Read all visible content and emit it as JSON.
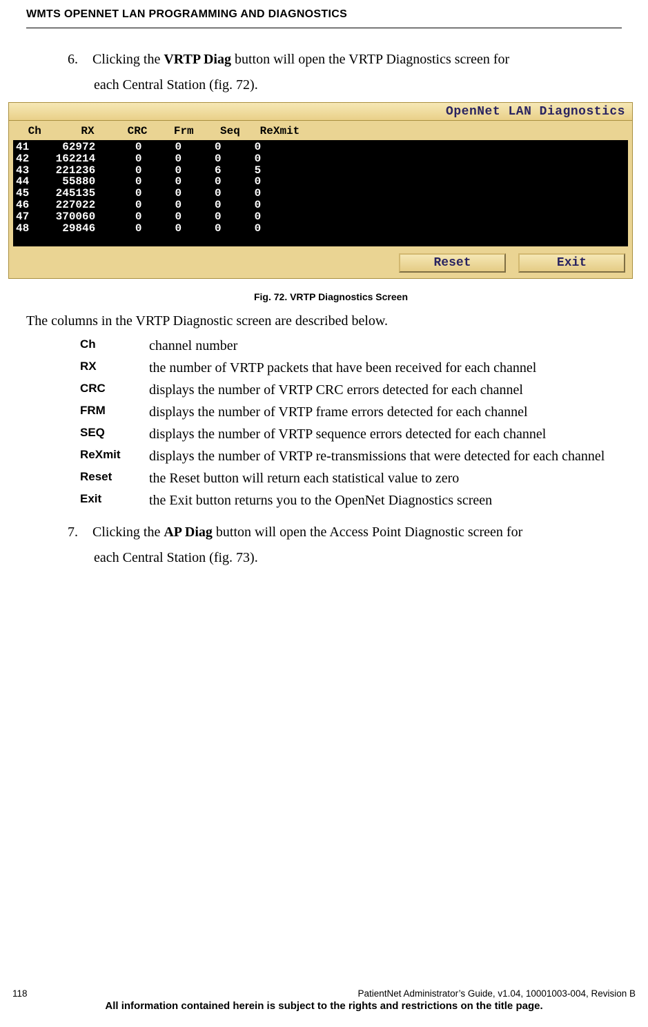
{
  "header": {
    "title": "WMTS OPENNET LAN PROGRAMMING AND DIAGNOSTICS"
  },
  "step6": {
    "num": "6.",
    "pre": "Clicking the ",
    "bold": "VRTP Diag",
    "mid": " button will open the VRTP Diagnostics screen for",
    "line2": "each Central Station (fig. 72)."
  },
  "diag": {
    "title": "OpenNet LAN Diagnostics",
    "headers": " Ch      RX     CRC    Frm    Seq   ReXmit",
    "rows": [
      {
        "ch": "41",
        "rx": "62972",
        "crc": "0",
        "frm": "0",
        "seq": "0",
        "rexmit": "0"
      },
      {
        "ch": "42",
        "rx": "162214",
        "crc": "0",
        "frm": "0",
        "seq": "0",
        "rexmit": "0"
      },
      {
        "ch": "43",
        "rx": "221236",
        "crc": "0",
        "frm": "0",
        "seq": "6",
        "rexmit": "5"
      },
      {
        "ch": "44",
        "rx": "55880",
        "crc": "0",
        "frm": "0",
        "seq": "0",
        "rexmit": "0"
      },
      {
        "ch": "45",
        "rx": "245135",
        "crc": "0",
        "frm": "0",
        "seq": "0",
        "rexmit": "0"
      },
      {
        "ch": "46",
        "rx": "227022",
        "crc": "0",
        "frm": "0",
        "seq": "0",
        "rexmit": "0"
      },
      {
        "ch": "47",
        "rx": "370060",
        "crc": "0",
        "frm": "0",
        "seq": "0",
        "rexmit": "0"
      },
      {
        "ch": "48",
        "rx": "29846",
        "crc": "0",
        "frm": "0",
        "seq": "0",
        "rexmit": "0"
      }
    ],
    "buttons": {
      "reset": "Reset",
      "exit": "Exit"
    }
  },
  "figcaption": "Fig. 72. VRTP Diagnostics Screen",
  "lead": "The columns in the VRTP Diagnostic screen are described below.",
  "defs": [
    {
      "term": "Ch",
      "desc": "channel number"
    },
    {
      "term": "RX",
      "desc": "the number of VRTP packets that have been received for each channel"
    },
    {
      "term": "CRC",
      "desc": "displays the number of VRTP CRC errors detected for each channel"
    },
    {
      "term": "FRM",
      "desc": "displays the number of VRTP frame errors detected for each channel"
    },
    {
      "term": "SEQ",
      "desc": "displays the number of VRTP sequence errors detected for each channel"
    },
    {
      "term": "ReXmit",
      "desc": "displays the number of VRTP re-transmissions that were detected for each channel"
    },
    {
      "term": "Reset",
      "desc": "the Reset button will return each statistical value to zero"
    },
    {
      "term": "Exit",
      "desc": "the Exit button returns you to the OpenNet Diagnostics screen"
    }
  ],
  "step7": {
    "num": "7.",
    "pre": "Clicking the ",
    "bold": "AP Diag",
    "mid": " button will open the Access Point Diagnostic screen for",
    "line2": "each Central Station (fig. 73)."
  },
  "footer": {
    "page": "118",
    "right": "PatientNet Administrator’s Guide, v1.04, 10001003-004, Revision B",
    "notice": "All information contained herein is subject to the rights and restrictions on the title page."
  }
}
